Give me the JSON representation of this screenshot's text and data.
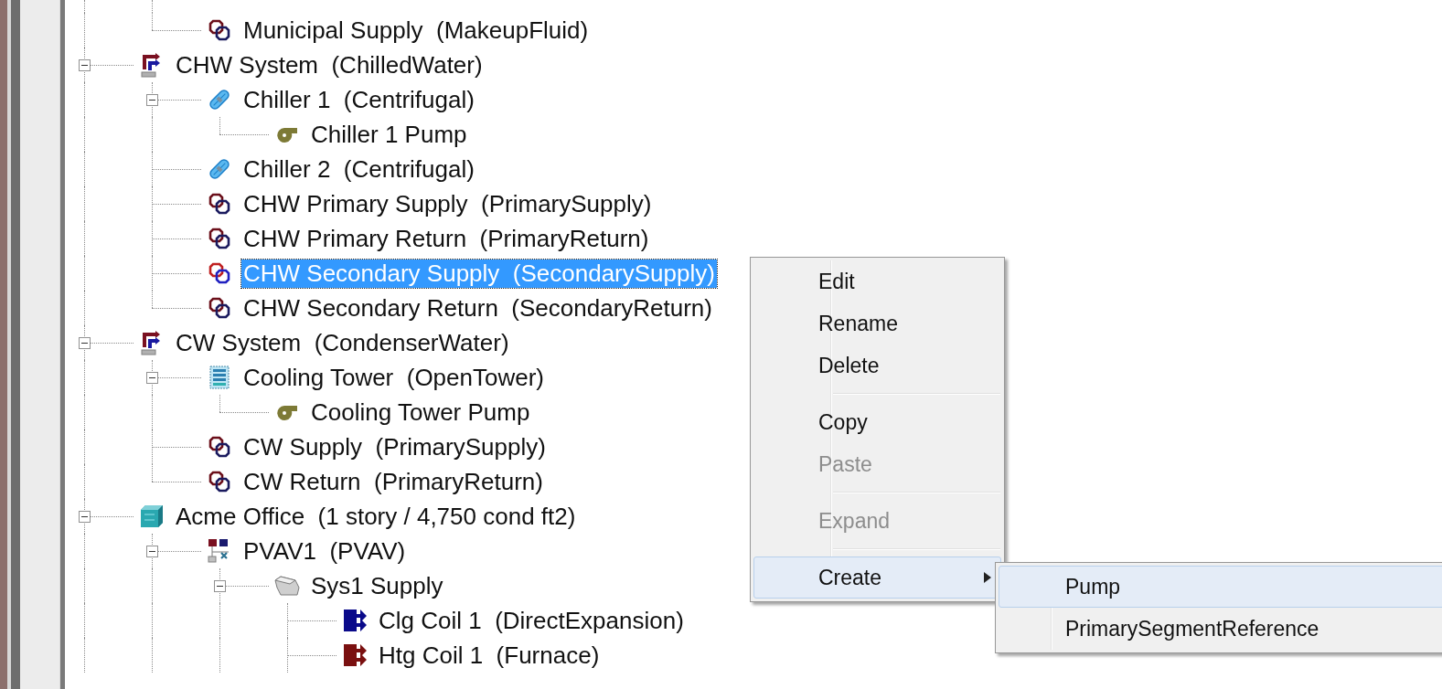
{
  "tree": {
    "orphan_children": [
      {
        "label": "Municipal Supply  (MakeupFluid)",
        "kind": "pipe",
        "selected": false
      }
    ],
    "nodes": [
      {
        "label": "CHW System  (ChilledWater)",
        "kind": "system",
        "selected": false,
        "expanded": true,
        "children": [
          {
            "label": "Chiller 1  (Centrifugal)",
            "kind": "chiller",
            "selected": false,
            "expanded": true,
            "children": [
              {
                "label": "Chiller 1 Pump",
                "kind": "pump",
                "selected": false
              }
            ]
          },
          {
            "label": "Chiller 2  (Centrifugal)",
            "kind": "chiller",
            "selected": false
          },
          {
            "label": "CHW Primary Supply  (PrimarySupply)",
            "kind": "pipe",
            "selected": false
          },
          {
            "label": "CHW Primary Return  (PrimaryReturn)",
            "kind": "pipe",
            "selected": false
          },
          {
            "label": "CHW Secondary Supply  (SecondarySupply)",
            "kind": "pipe",
            "selected": true
          },
          {
            "label": "CHW Secondary Return  (SecondaryReturn)",
            "kind": "pipe",
            "selected": false
          }
        ]
      },
      {
        "label": "CW System  (CondenserWater)",
        "kind": "system",
        "selected": false,
        "expanded": true,
        "children": [
          {
            "label": "Cooling Tower  (OpenTower)",
            "kind": "tower",
            "selected": false,
            "expanded": true,
            "children": [
              {
                "label": "Cooling Tower Pump",
                "kind": "pump",
                "selected": false
              }
            ]
          },
          {
            "label": "CW Supply  (PrimarySupply)",
            "kind": "pipe",
            "selected": false
          },
          {
            "label": "CW Return  (PrimaryReturn)",
            "kind": "pipe",
            "selected": false
          }
        ]
      },
      {
        "label": "Acme Office  (1 story / 4,750 cond ft2)",
        "kind": "building",
        "selected": false,
        "expanded": true,
        "children": [
          {
            "label": "PVAV1  (PVAV)",
            "kind": "airsys",
            "selected": false,
            "expanded": true,
            "children": [
              {
                "label": "Sys1 Supply",
                "kind": "duct",
                "selected": false,
                "expanded": true,
                "children": [
                  {
                    "label": "Clg Coil 1  (DirectExpansion)",
                    "kind": "coil_cool",
                    "selected": false
                  },
                  {
                    "label": "Htg Coil 1  (Furnace)",
                    "kind": "coil_heat",
                    "selected": false
                  }
                ]
              }
            ]
          }
        ]
      }
    ]
  },
  "context_menu": {
    "items": [
      {
        "kind": "item",
        "label": "Edit",
        "disabled": false,
        "selected": false
      },
      {
        "kind": "item",
        "label": "Rename",
        "disabled": false,
        "selected": false
      },
      {
        "kind": "item",
        "label": "Delete",
        "disabled": false,
        "selected": false
      },
      {
        "kind": "separator"
      },
      {
        "kind": "item",
        "label": "Copy",
        "disabled": false,
        "selected": false
      },
      {
        "kind": "item",
        "label": "Paste",
        "disabled": true,
        "selected": false
      },
      {
        "kind": "separator"
      },
      {
        "kind": "item",
        "label": "Expand",
        "disabled": true,
        "selected": false
      },
      {
        "kind": "separator"
      },
      {
        "kind": "submenu",
        "label": "Create",
        "disabled": false,
        "selected": true
      }
    ],
    "submenu": [
      {
        "label": "Pump",
        "selected": true
      },
      {
        "label": "PrimarySegmentReference",
        "selected": false
      }
    ]
  }
}
